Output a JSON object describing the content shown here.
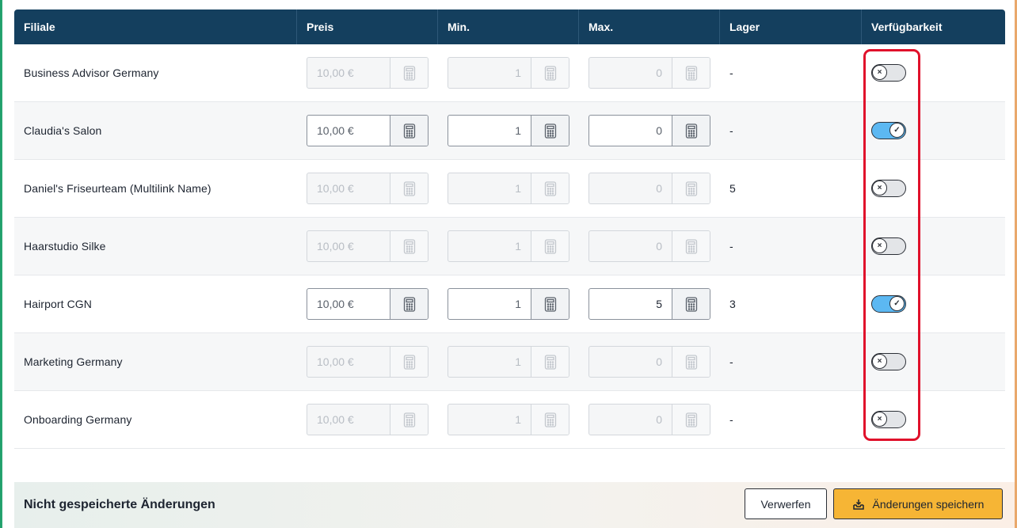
{
  "table": {
    "headers": {
      "filiale": "Filiale",
      "preis": "Preis",
      "min": "Min.",
      "max": "Max.",
      "lager": "Lager",
      "verfuegbarkeit": "Verfügbarkeit"
    },
    "rows": [
      {
        "name": "Business Advisor Germany",
        "preis": "10,00 €",
        "min": "1",
        "max": "0",
        "lager": "-",
        "available": false
      },
      {
        "name": "Claudia's Salon",
        "preis": "10,00 €",
        "min": "1",
        "max": "0",
        "lager": "-",
        "available": true
      },
      {
        "name": "Daniel's Friseurteam (Multilink Name)",
        "preis": "10,00 €",
        "min": "1",
        "max": "0",
        "lager": "5",
        "available": false
      },
      {
        "name": "Haarstudio Silke",
        "preis": "10,00 €",
        "min": "1",
        "max": "0",
        "lager": "-",
        "available": false
      },
      {
        "name": "Hairport CGN",
        "preis": "10,00 €",
        "min": "1",
        "max": "5",
        "lager": "3",
        "available": true
      },
      {
        "name": "Marketing Germany",
        "preis": "10,00 €",
        "min": "1",
        "max": "0",
        "lager": "-",
        "available": false
      },
      {
        "name": "Onboarding Germany",
        "preis": "10,00 €",
        "min": "1",
        "max": "0",
        "lager": "-",
        "available": false
      }
    ]
  },
  "icons": {
    "calculator": "calculator-icon",
    "toggle_on": "check-icon",
    "toggle_off": "x-icon",
    "save": "inbox-download-icon"
  },
  "colors": {
    "header_bg": "#143f5e",
    "toggle_on": "#5cb8f2",
    "highlight": "#e0112b",
    "save_button": "#f6b535"
  },
  "footer": {
    "title": "Nicht gespeicherte Änderungen",
    "discard_label": "Verwerfen",
    "save_label": "Änderungen speichern"
  }
}
